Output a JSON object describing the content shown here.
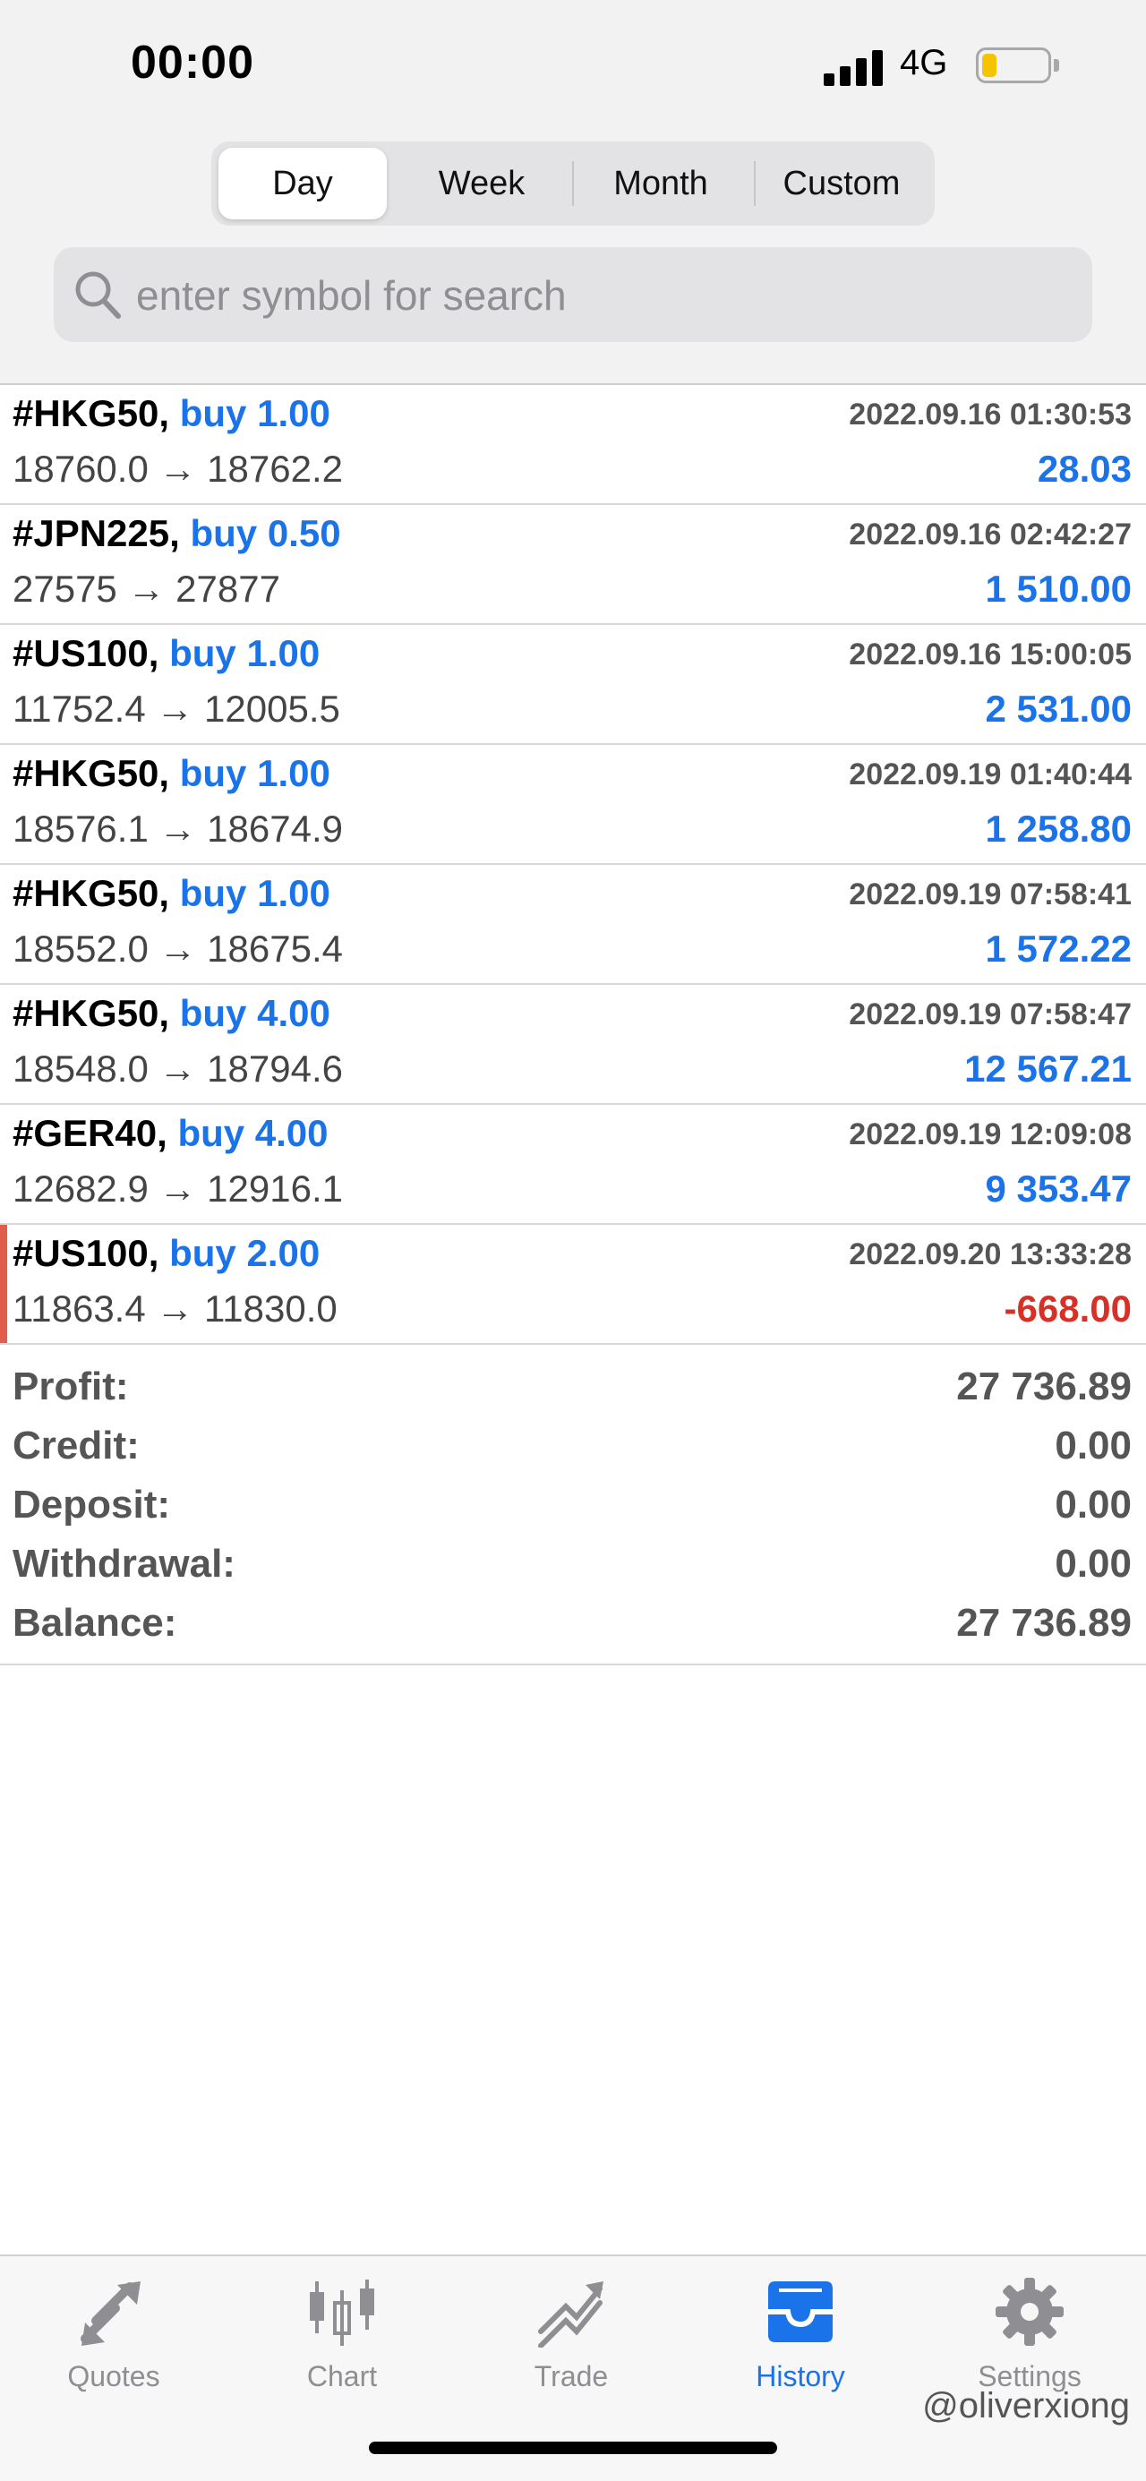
{
  "status_bar": {
    "time": "00:00",
    "network": "4G"
  },
  "period_tabs": [
    "Day",
    "Week",
    "Month",
    "Custom"
  ],
  "active_period": "Day",
  "search": {
    "placeholder": "enter symbol for search"
  },
  "deals": [
    {
      "symbol": "#HKG50,",
      "side": "buy 1.00",
      "datetime": "2022.09.16 01:30:53",
      "prices": "18760.0 → 18762.2",
      "profit": "28.03"
    },
    {
      "symbol": "#JPN225,",
      "side": "buy 0.50",
      "datetime": "2022.09.16 02:42:27",
      "prices": "27575 → 27877",
      "profit": "1 510.00"
    },
    {
      "symbol": "#US100,",
      "side": "buy 1.00",
      "datetime": "2022.09.16 15:00:05",
      "prices": "11752.4 → 12005.5",
      "profit": "2 531.00"
    },
    {
      "symbol": "#HKG50,",
      "side": "buy 1.00",
      "datetime": "2022.09.19 01:40:44",
      "prices": "18576.1 → 18674.9",
      "profit": "1 258.80"
    },
    {
      "symbol": "#HKG50,",
      "side": "buy 1.00",
      "datetime": "2022.09.19 07:58:41",
      "prices": "18552.0 → 18675.4",
      "profit": "1 572.22"
    },
    {
      "symbol": "#HKG50,",
      "side": "buy 4.00",
      "datetime": "2022.09.19 07:58:47",
      "prices": "18548.0 → 18794.6",
      "profit": "12 567.21"
    },
    {
      "symbol": "#GER40,",
      "side": "buy 4.00",
      "datetime": "2022.09.19 12:09:08",
      "prices": "12682.9 → 12916.1",
      "profit": "9 353.47"
    },
    {
      "symbol": "#US100,",
      "side": "buy 2.00",
      "datetime": "2022.09.20 13:33:28",
      "prices": "11863.4 → 11830.0",
      "profit": "-668.00"
    }
  ],
  "summary": [
    {
      "label": "Profit:",
      "value": "27 736.89"
    },
    {
      "label": "Credit:",
      "value": "0.00"
    },
    {
      "label": "Deposit:",
      "value": "0.00"
    },
    {
      "label": "Withdrawal:",
      "value": "0.00"
    },
    {
      "label": "Balance:",
      "value": "27 736.89"
    }
  ],
  "tabbar": {
    "items": [
      {
        "label": "Quotes",
        "icon": "quotes-icon"
      },
      {
        "label": "Chart",
        "icon": "candlestick-icon"
      },
      {
        "label": "Trade",
        "icon": "trade-icon"
      },
      {
        "label": "History",
        "icon": "inbox-icon"
      },
      {
        "label": "Settings",
        "icon": "gear-icon"
      }
    ],
    "active": "History"
  },
  "watermark": "@oliverxiong",
  "colors": {
    "accent": "#1a73e8",
    "loss": "#d93025",
    "marker": "#e05c4b"
  }
}
